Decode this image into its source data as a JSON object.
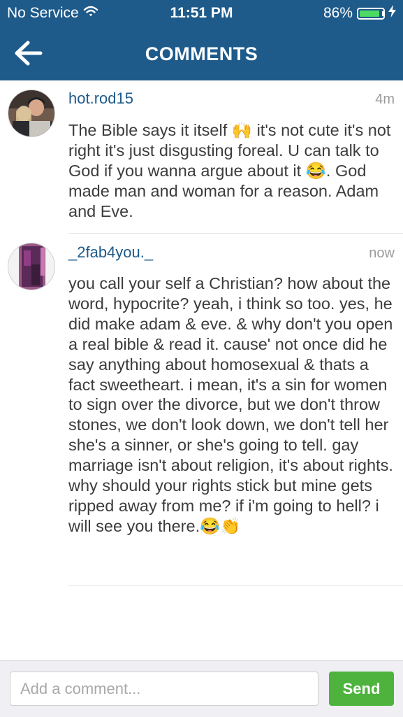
{
  "status_bar": {
    "carrier": "No Service",
    "time": "11:51 PM",
    "battery": "86%",
    "battery_level": 0.86,
    "wifi_icon": "wifi-icon",
    "charging_icon": "lightning-bolt-icon"
  },
  "nav": {
    "title": "COMMENTS",
    "back_icon": "back-arrow-icon"
  },
  "comments": [
    {
      "username": "hot.rod15",
      "time": "4m",
      "text": "The Bible says it itself 🙌 it's not cute it's not right it's just disgusting foreal. U can talk to God if you wanna argue about it 😂. God made man and woman for a reason. Adam and Eve."
    },
    {
      "username": "_2fab4you._",
      "time": "now",
      "text": "you call your self a Christian? how about the word, hypocrite? yeah, i think so too. yes, he did make adam & eve. & why don't you open a real bible & read it. cause' not once did he say anything about homosexual & thats a fact sweetheart. i mean, it's a sin for women to sign over the divorce, but we don't throw stones, we don't look down, we don't tell her she's a sinner, or she's going to tell. gay marriage isn't about religion, it's about rights. why should your rights stick but mine gets ripped away from me? if i'm going to hell? i will see you there.😂👏"
    }
  ],
  "composer": {
    "placeholder": "Add a comment...",
    "value": "",
    "send_label": "Send"
  },
  "colors": {
    "header": "#1e5a8a",
    "username": "#1e5a8a",
    "send_button": "#4db33d",
    "battery_fill": "#4cd964"
  }
}
